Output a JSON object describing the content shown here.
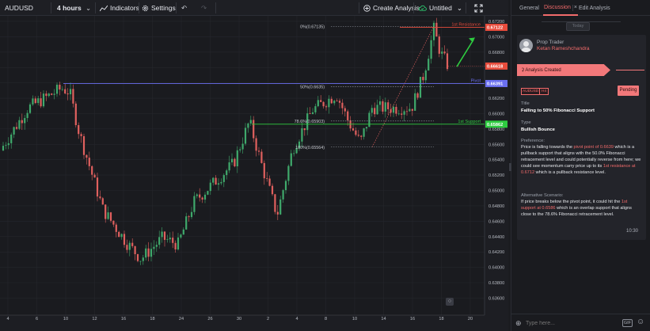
{
  "toolbar": {
    "symbol": "AUDUSD",
    "interval": "4 hours",
    "indicators": "Indicators",
    "settings": "Settings",
    "create_analysis": "Create Analysis",
    "layout_name": "Untitled"
  },
  "chart_data": {
    "type": "candlestick",
    "symbol": "AUDUSD",
    "timeframe": "4 hours",
    "y_ticks": [
      "0.67200",
      "0.67000",
      "0.66800",
      "0.66600",
      "0.66400",
      "0.66200",
      "0.66000",
      "0.65800",
      "0.65600",
      "0.65400",
      "0.65200",
      "0.65000",
      "0.64800",
      "0.64600",
      "0.64400",
      "0.64200",
      "0.64000",
      "0.63800",
      "0.63600"
    ],
    "x_ticks": [
      "4",
      "6",
      "10",
      "12",
      "16",
      "18",
      "24",
      "26",
      "30",
      "2",
      "4",
      "8",
      "10",
      "14",
      "16",
      "18",
      "20"
    ],
    "levels": [
      {
        "label": "1st Resistance",
        "value": "0.67122",
        "color": "#e74c3c"
      },
      {
        "label": "Pivot",
        "value": "0.66391",
        "color": "#6a6ff0"
      },
      {
        "label": "1st Support",
        "value": "0.65862",
        "color": "#2ecc40"
      }
    ],
    "last_price": "0.66618",
    "fibonacci": [
      {
        "label": "0%(0.67135)"
      },
      {
        "label": "50%(0.6635)"
      },
      {
        "label": "78.6%(0.65903)"
      },
      {
        "label": "100%(0.65564)"
      }
    ],
    "ylim": [
      0.6346,
      0.6722
    ]
  },
  "panel": {
    "tabs": [
      "General",
      "Discussion",
      "Edit Analysis"
    ],
    "date_chip": "Today",
    "author_role": "Prop Trader",
    "author_name": "Ketan Rameshchandra",
    "status_banner": "Analysis Created",
    "badges": [
      "AUDUSD",
      "H4"
    ],
    "status_button": "Pending",
    "title_label": "Title",
    "title_value": "Falling to 50% Fibonacci Support",
    "type_label": "Type",
    "type_value": "Bullish Bounce",
    "preference_label": "Preference:",
    "preference_parts": [
      "Price is falling towards the ",
      "pivot point of 0.6639",
      " which is a pullback support that aligns with the 50.0% Fibonacci retracement level and could potentially reverse from here; we could see momentum carry price up to its ",
      "1st resistance at 0.6712",
      " which is a pullback resistance level."
    ],
    "alternative_label": "Alternative Scenario:",
    "alternative_parts": [
      "If price breaks below the pivot point, it could hit the ",
      "1st support at 0.6586",
      " which is an overlap support that aligns close to the 78.6% Fibonacci retracement level."
    ],
    "time": "10:30",
    "input_placeholder": "Type here...",
    "gif_label": "GIF"
  }
}
